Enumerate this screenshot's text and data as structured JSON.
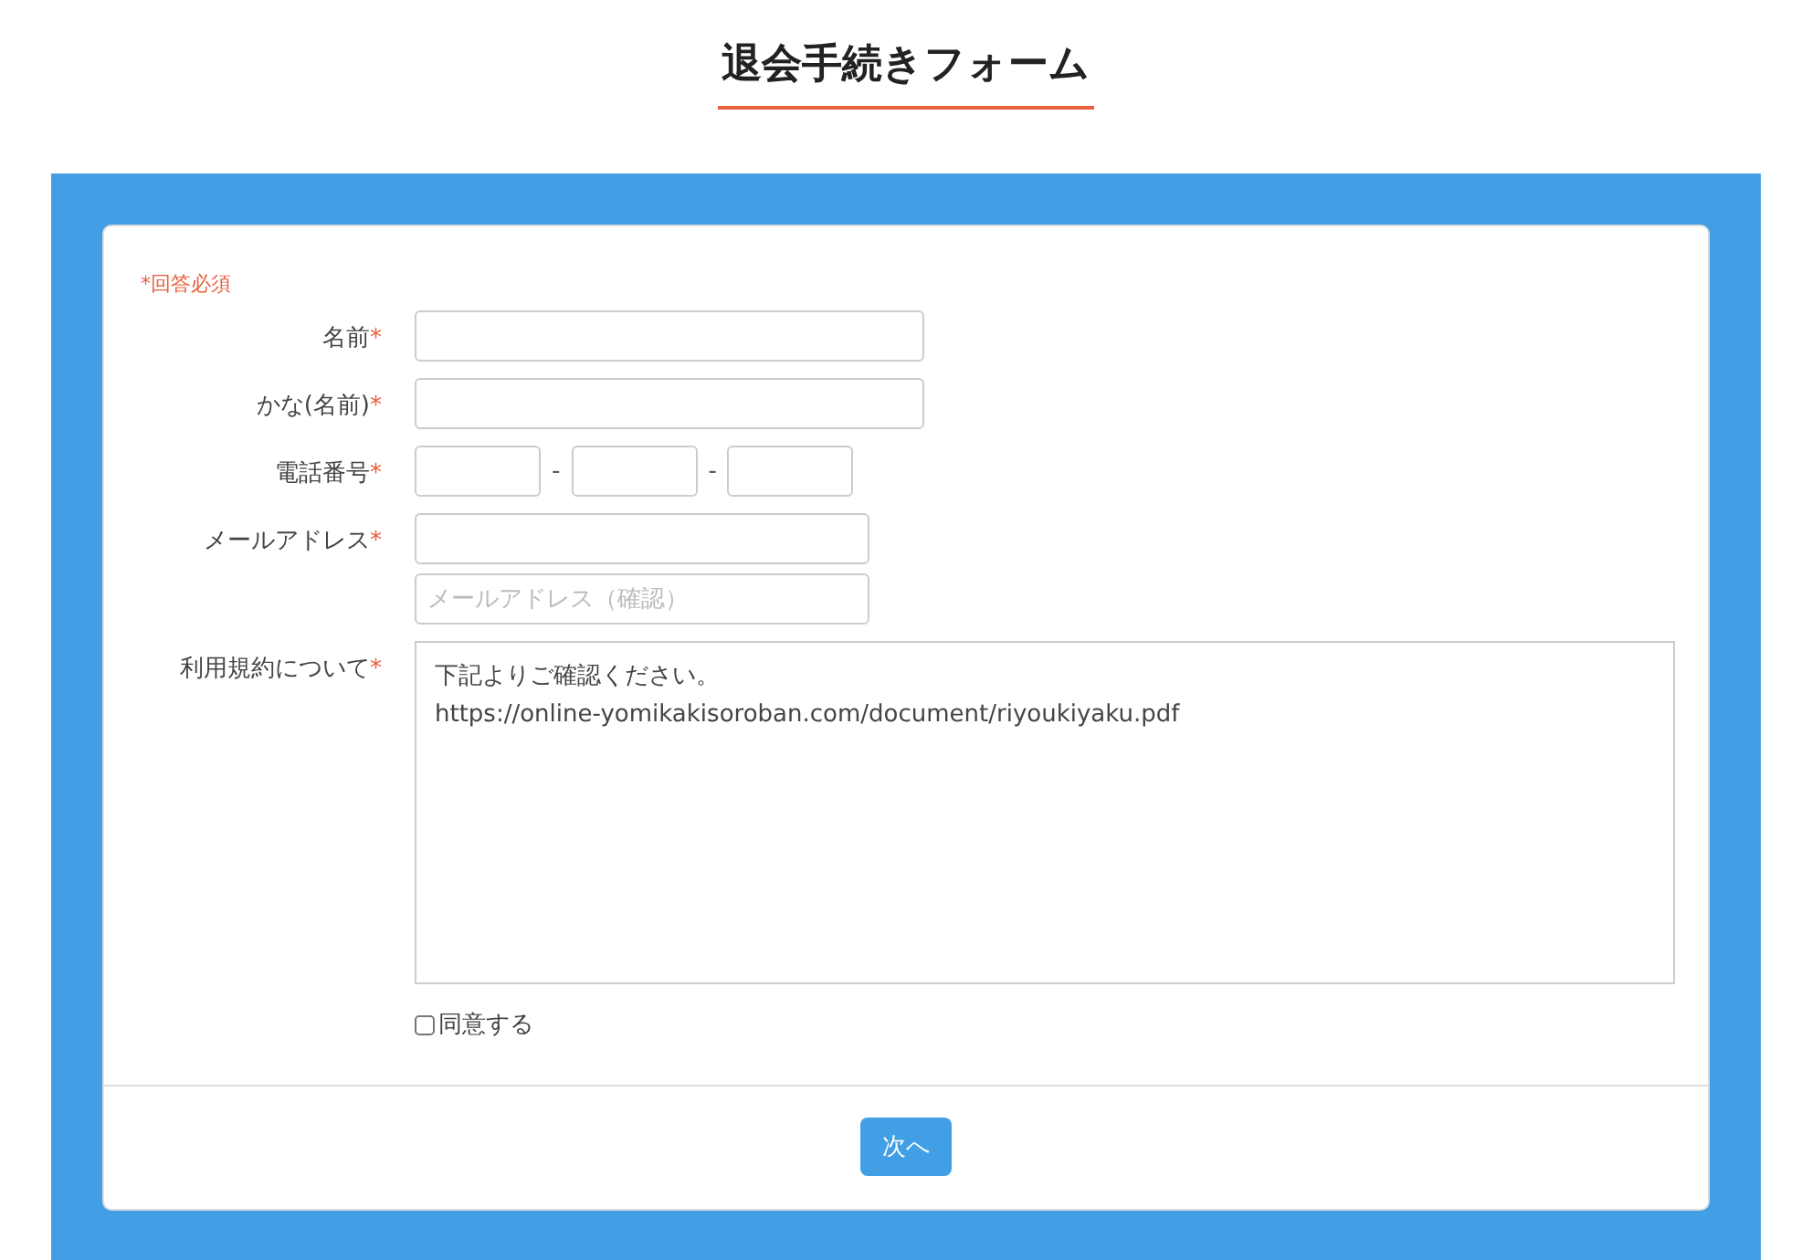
{
  "title": "退会手続きフォーム",
  "required_note": "*回答必須",
  "fields": [
    {
      "kind": "text",
      "label": "名前",
      "required_mark": "*"
    },
    {
      "kind": "text",
      "label": "かな(名前)",
      "required_mark": "*"
    },
    {
      "kind": "phone",
      "label": "電話番号",
      "required_mark": "*",
      "separators": [
        "-",
        "-"
      ]
    },
    {
      "kind": "email",
      "label": "メールアドレス",
      "required_mark": "*",
      "confirm_placeholder": "メールアドレス（確認）"
    },
    {
      "kind": "terms",
      "label": "利用規約について",
      "required_mark": "*",
      "lines": [
        "下記よりご確認ください。",
        "https://online-yomikakisoroban.com/document/riyoukiyaku.pdf"
      ]
    }
  ],
  "agreement": {
    "label": "同意する",
    "checked": false
  },
  "next_button": "次へ"
}
